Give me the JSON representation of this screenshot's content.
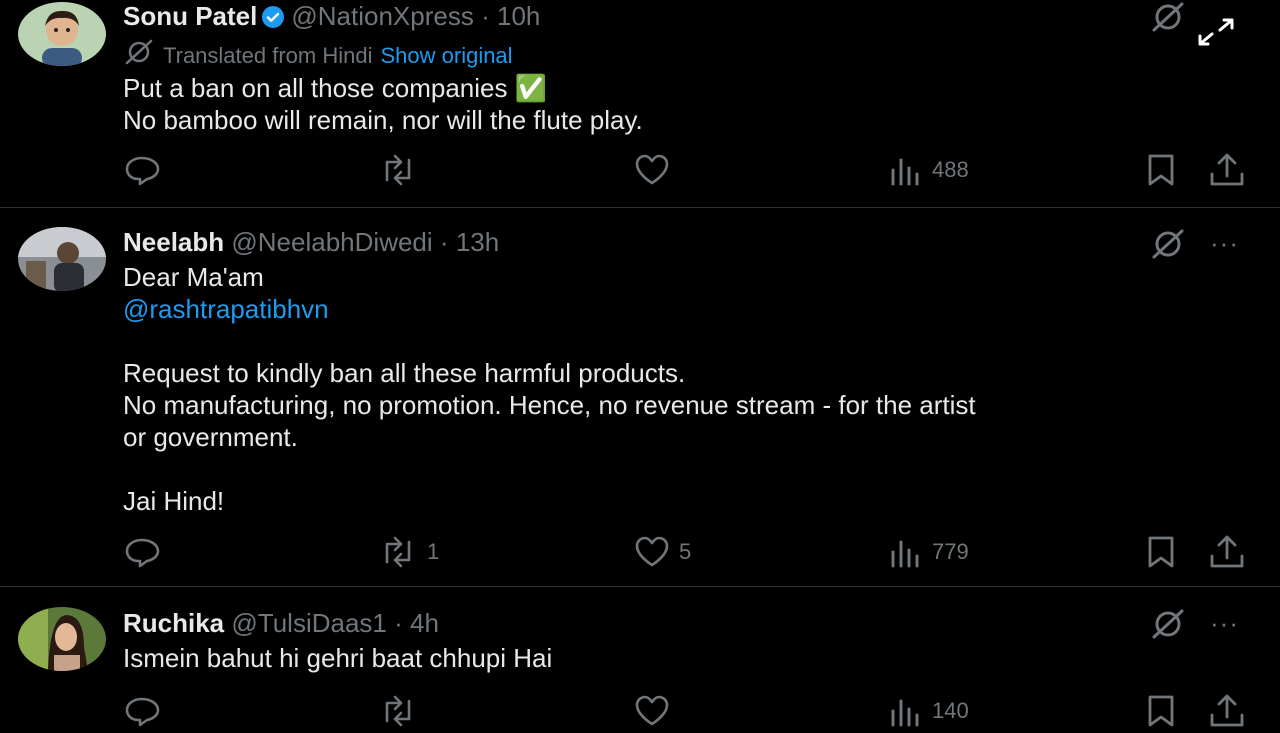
{
  "posts": [
    {
      "name": "Sonu Patel",
      "handle": "@NationXpress",
      "time": "10h",
      "verified": true,
      "translated_label": "Translated from Hindi",
      "show_original": "Show original",
      "lines": [
        "Put a ban on all those companies ✅",
        "No bamboo will remain, nor will the flute play."
      ],
      "replies": "",
      "reposts": "",
      "likes": "",
      "views": "488"
    },
    {
      "name": "Neelabh",
      "handle": "@NeelabhDiwedi",
      "time": "13h",
      "greeting": "Dear Ma'am",
      "mention": "@rashtrapatibhvn",
      "lines": [
        "Request to kindly ban all these harmful products.",
        "No manufacturing, no promotion. Hence, no revenue stream - for the artist",
        "or government."
      ],
      "closing": "Jai Hind!",
      "replies": "",
      "reposts": "1",
      "likes": "5",
      "views": "779"
    },
    {
      "name": "Ruchika",
      "handle": "@TulsiDaas1",
      "time": "4h",
      "lines": [
        "Ismein bahut hi gehri baat chhupi Hai"
      ],
      "views": "140"
    }
  ],
  "separator": "·",
  "more_label": "···",
  "icons": {
    "reply": "reply-icon",
    "repost": "repost-icon",
    "like": "like-icon",
    "views": "views-icon",
    "bookmark": "bookmark-icon",
    "share": "share-icon",
    "grok": "grok-icon",
    "more": "more-icon",
    "expand": "expand-icon",
    "verified": "verified-badge-icon"
  },
  "colors": {
    "background": "#000000",
    "text": "#e7e9ea",
    "muted": "#71767b",
    "link": "#1d9bf0",
    "divider": "#2f3336"
  }
}
